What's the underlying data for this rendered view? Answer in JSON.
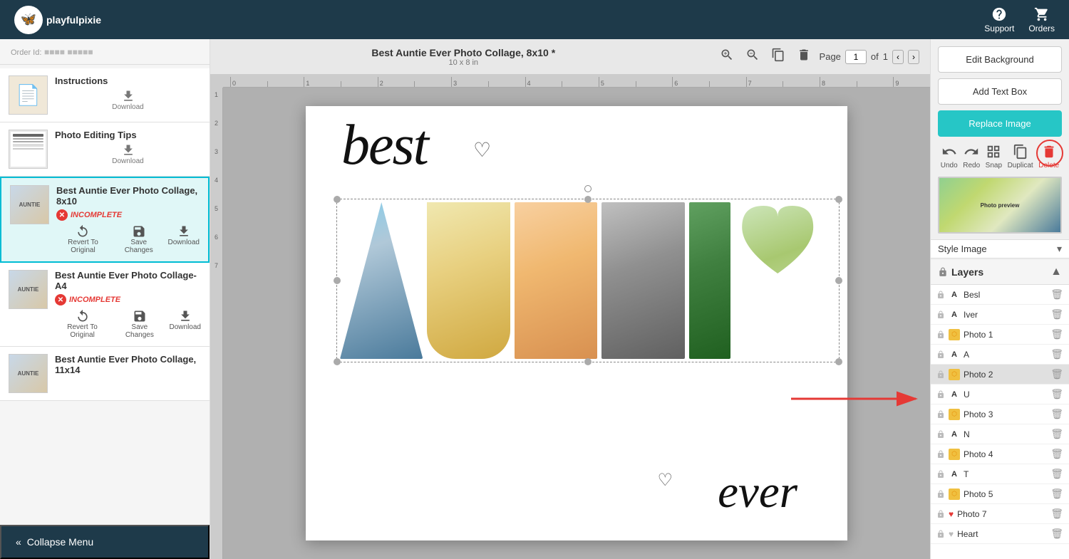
{
  "navbar": {
    "logo_text": "playfulpixie",
    "support_label": "Support",
    "orders_label": "Orders"
  },
  "order": {
    "id_label": "Order Id:",
    "id_value": "PPP-XXXXX"
  },
  "sidebar": {
    "items": [
      {
        "id": "instructions",
        "title": "Instructions",
        "action": "Download",
        "type": "simple"
      },
      {
        "id": "photo-editing-tips",
        "title": "Photo Editing Tips",
        "action": "Download",
        "type": "simple"
      },
      {
        "id": "collage-8x10",
        "title": "Best Auntie Ever Photo Collage, 8x10",
        "status": "INCOMPLETE",
        "actions": [
          "Revert To Original",
          "Save Changes",
          "Download"
        ],
        "type": "collage",
        "active": true
      },
      {
        "id": "collage-a4",
        "title": "Best Auntie Ever Photo Collage- A4",
        "status": "INCOMPLETE",
        "actions": [
          "Revert To Original",
          "Save Changes",
          "Download"
        ],
        "type": "collage"
      },
      {
        "id": "collage-11x14",
        "title": "Best Auntie Ever Photo Collage, 11x14",
        "type": "collage-simple"
      }
    ],
    "collapse_label": "Collapse Menu"
  },
  "canvas": {
    "title": "Best Auntie Ever Photo Collage, 8x10 *",
    "subtitle": "10 x 8 in",
    "page_label": "Page",
    "page_num": "1",
    "of_label": "of",
    "total_pages": "1",
    "best_text": "best",
    "ever_text": "ever"
  },
  "toolbar": {
    "undo_label": "Undo",
    "redo_label": "Redo",
    "snap_label": "Snap",
    "duplicate_label": "Duplicat",
    "delete_label": "Delete"
  },
  "right_panel": {
    "edit_background_label": "Edit Background",
    "add_text_box_label": "Add Text Box",
    "replace_image_label": "Replace Image",
    "style_image_label": "Style Image",
    "layers_title": "Layers",
    "layers": [
      {
        "id": "besl",
        "name": "Besl",
        "type": "A",
        "lock": true,
        "delete": true
      },
      {
        "id": "iver",
        "name": "Iver",
        "type": "A",
        "lock": true,
        "delete": true
      },
      {
        "id": "photo1",
        "name": "Photo 1",
        "type": "photo",
        "lock": true,
        "delete": true
      },
      {
        "id": "a",
        "name": "A",
        "type": "A",
        "lock": true,
        "delete": true
      },
      {
        "id": "photo2",
        "name": "Photo 2",
        "type": "photo",
        "lock": true,
        "delete": true,
        "active": true
      },
      {
        "id": "u",
        "name": "U",
        "type": "A",
        "lock": true,
        "delete": true
      },
      {
        "id": "photo3",
        "name": "Photo 3",
        "type": "photo",
        "lock": true,
        "delete": true
      },
      {
        "id": "n",
        "name": "N",
        "type": "A",
        "lock": true,
        "delete": true
      },
      {
        "id": "photo4",
        "name": "Photo 4",
        "type": "photo",
        "lock": true,
        "delete": true
      },
      {
        "id": "t",
        "name": "T",
        "type": "A",
        "lock": true,
        "delete": true
      },
      {
        "id": "photo5",
        "name": "Photo 5",
        "type": "photo",
        "lock": true,
        "delete": true
      },
      {
        "id": "photo7",
        "name": "Photo 7",
        "type": "heart-photo",
        "lock": true,
        "delete": true
      },
      {
        "id": "heart",
        "name": "Heart",
        "type": "heart",
        "lock": true,
        "delete": true
      }
    ]
  }
}
